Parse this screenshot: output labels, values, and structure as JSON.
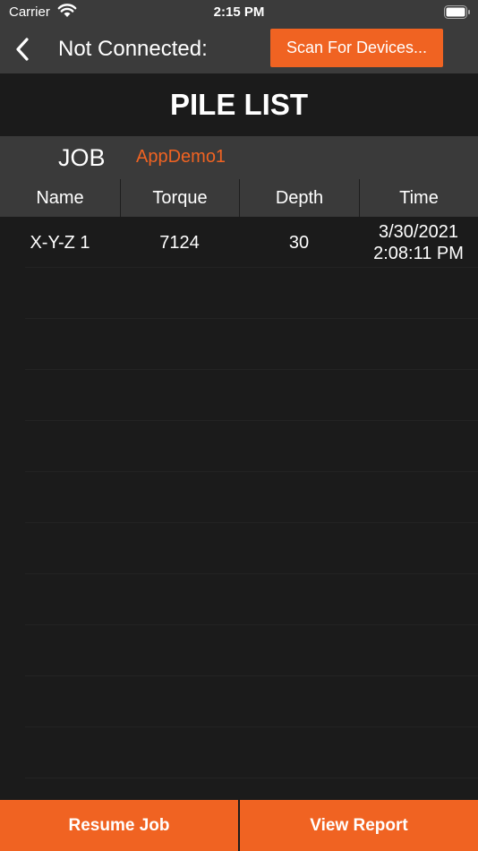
{
  "status_bar": {
    "carrier": "Carrier",
    "time": "2:15 PM"
  },
  "nav": {
    "title": "Not Connected:",
    "scan_label": "Scan For Devices..."
  },
  "page": {
    "title": "PILE LIST"
  },
  "job": {
    "label": "JOB",
    "name": "AppDemo1"
  },
  "table": {
    "columns": [
      "Name",
      "Torque",
      "Depth",
      "Time"
    ],
    "rows": [
      {
        "name": "X-Y-Z 1",
        "torque": "7124",
        "depth": "30",
        "date": "3/30/2021",
        "time": "2:08:11 PM"
      }
    ]
  },
  "actions": {
    "resume_label": "Resume Job",
    "report_label": "View Report"
  },
  "colors": {
    "accent": "#f06322",
    "bar": "#3b3b3b",
    "background": "#1b1b1b"
  },
  "icons": [
    "wifi-icon",
    "battery-icon",
    "back-chevron-icon"
  ]
}
